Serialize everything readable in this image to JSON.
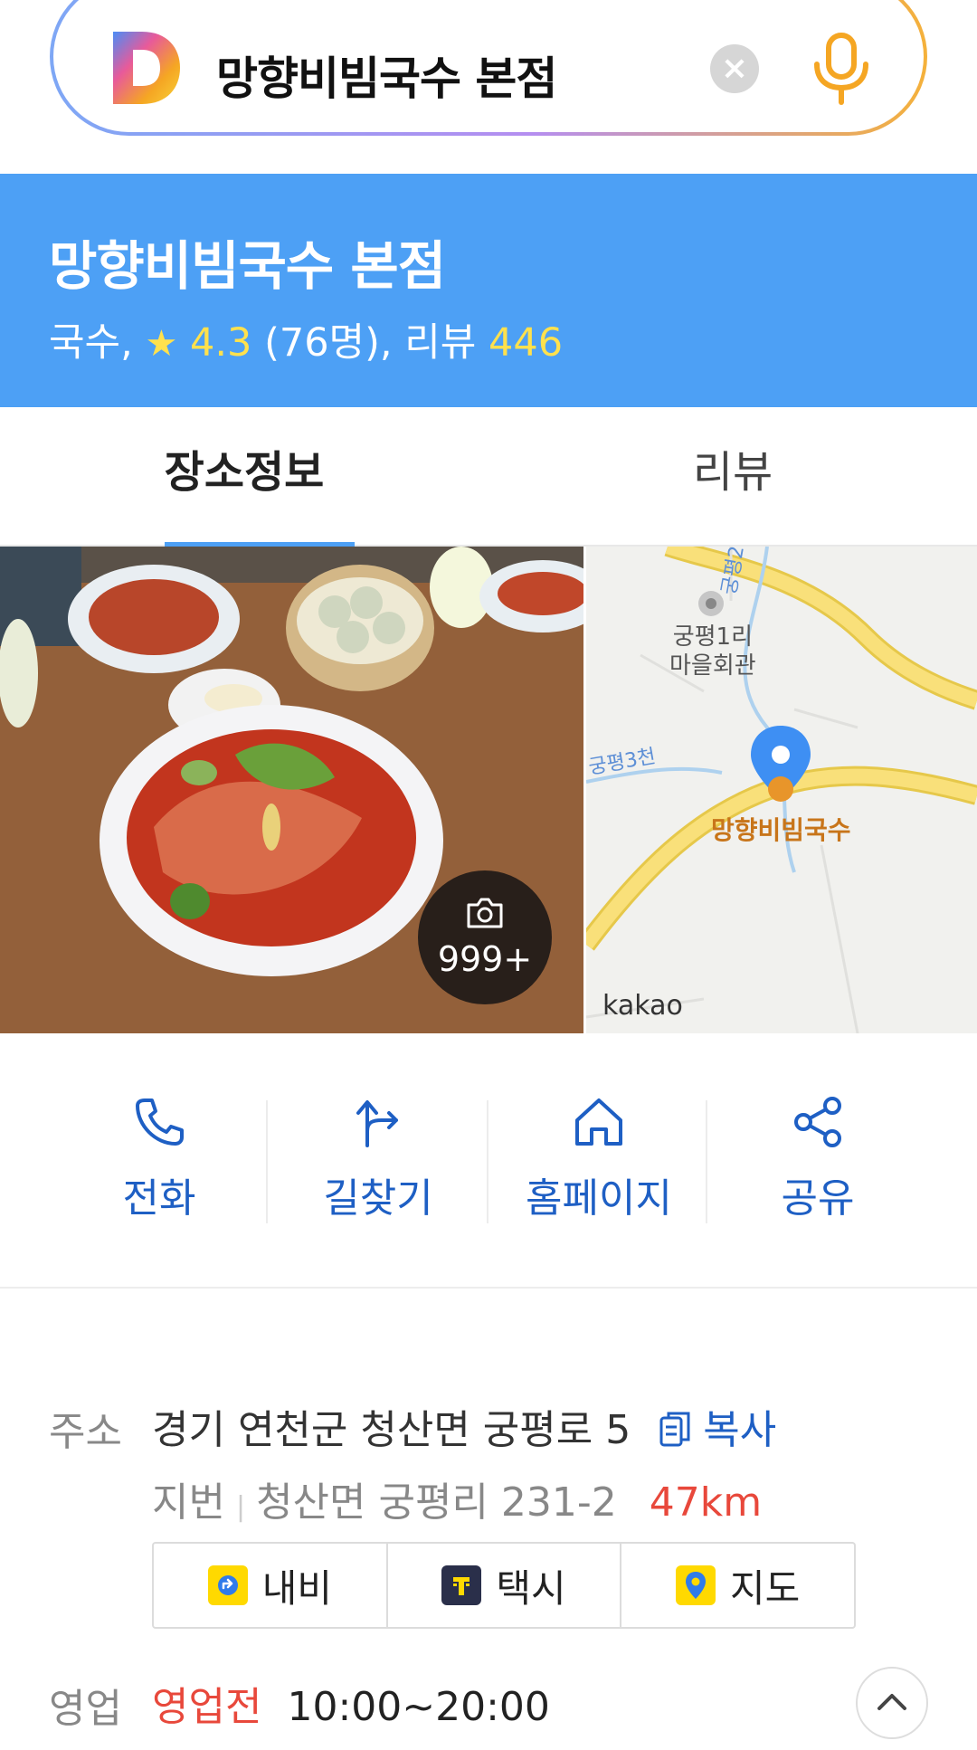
{
  "search": {
    "query": "망향비빔국수 본점",
    "clear_icon": "clear-icon",
    "mic_icon": "mic-icon"
  },
  "place": {
    "name": "망향비빔국수 본점",
    "category": "국수,",
    "rating": "4.3",
    "rating_count": "(76명),",
    "review_label": "리뷰",
    "review_count": "446"
  },
  "tabs": [
    {
      "label": "장소정보",
      "active": true
    },
    {
      "label": "리뷰",
      "active": false
    }
  ],
  "photo": {
    "count": "999+"
  },
  "map": {
    "kakao_label": "kakao",
    "poi_label_line1": "궁평1리",
    "poi_label_line2": "마을회관",
    "stream_label_1": "궁평2천",
    "stream_label_2": "궁평3천",
    "place_label": "망향비빔국수"
  },
  "actions": [
    {
      "label": "전화",
      "icon": "phone-icon"
    },
    {
      "label": "길찾기",
      "icon": "directions-icon"
    },
    {
      "label": "홈페이지",
      "icon": "home-icon"
    },
    {
      "label": "공유",
      "icon": "share-icon"
    }
  ],
  "address": {
    "key": "주소",
    "road": "경기 연천군 청산면 궁평로 5",
    "copy_label": "복사",
    "jibun_key": "지번",
    "jibun": "청산면 궁평리 231-2",
    "distance": "47km"
  },
  "nav_buttons": [
    {
      "label": "내비",
      "icon": "navi-icon",
      "color": "#ffd900"
    },
    {
      "label": "택시",
      "icon": "taxi-icon",
      "color": "#2a2f4a"
    },
    {
      "label": "지도",
      "icon": "map-pin-icon",
      "color": "#ffd900"
    }
  ],
  "hours": {
    "key": "영업",
    "status": "영업전",
    "time": "10:00~20:00"
  },
  "colors": {
    "header_blue": "#4da0f5",
    "link_blue": "#1e5fc4",
    "accent_red": "#e8483b",
    "rating_yellow": "#ffe14d"
  }
}
